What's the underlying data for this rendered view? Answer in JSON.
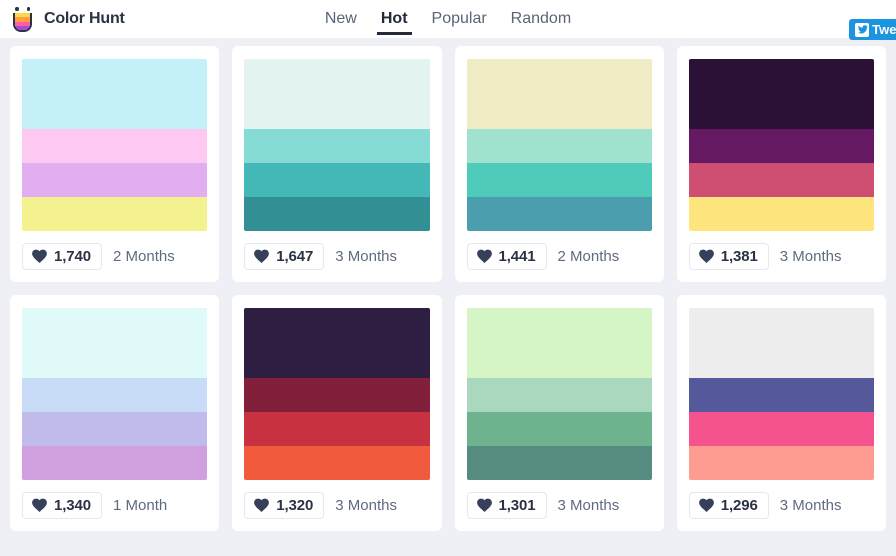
{
  "header": {
    "brand_name": "Color Hunt",
    "logo_icon": "color-hunt-cup-icon",
    "logo_colors": [
      "#ffd54a",
      "#ff9f40",
      "#ff5fa2",
      "#a64ad1"
    ],
    "nav": [
      {
        "label": "New",
        "active": false
      },
      {
        "label": "Hot",
        "active": true
      },
      {
        "label": "Popular",
        "active": false
      },
      {
        "label": "Random",
        "active": false
      }
    ],
    "tweet_widget": {
      "label": "Tweet",
      "icon": "twitter-bird-icon",
      "color": "#1b95e0"
    }
  },
  "theme": {
    "page_background": "#eef0f5",
    "card_background": "#ffffff",
    "text_primary": "#2b3245",
    "text_secondary": "#5f6b80",
    "accent": "#1b95e0"
  },
  "palettes": [
    {
      "colors": [
        "#c4f1f7",
        "#fdc8f2",
        "#e2aef2",
        "#f3f28f"
      ],
      "likes": "1,740",
      "age": "2 Months",
      "heart_icon": "heart-icon"
    },
    {
      "colors": [
        "#e2f3f0",
        "#86dcd4",
        "#44b8b6",
        "#328f93"
      ],
      "likes": "1,647",
      "age": "3 Months",
      "heart_icon": "heart-icon"
    },
    {
      "colors": [
        "#efecc6",
        "#a0e2cd",
        "#4ecbbb",
        "#4a9eae"
      ],
      "likes": "1,441",
      "age": "2 Months",
      "heart_icon": "heart-icon"
    },
    {
      "colors": [
        "#2b1136",
        "#651962",
        "#ce4f72",
        "#ffe57e"
      ],
      "likes": "1,381",
      "age": "3 Months",
      "heart_icon": "heart-icon"
    },
    {
      "colors": [
        "#dffaf9",
        "#c9dcf7",
        "#c0bbeb",
        "#cf9fe0"
      ],
      "likes": "1,340",
      "age": "1 Month",
      "heart_icon": "heart-icon"
    },
    {
      "colors": [
        "#2e1f42",
        "#82203c",
        "#c8313f",
        "#f15a3d"
      ],
      "likes": "1,320",
      "age": "3 Months",
      "heart_icon": "heart-icon"
    },
    {
      "colors": [
        "#d6f5c6",
        "#a9d8bf",
        "#6fb28e",
        "#558c7f"
      ],
      "likes": "1,301",
      "age": "3 Months",
      "heart_icon": "heart-icon"
    },
    {
      "colors": [
        "#ededed",
        "#55599b",
        "#f4538d",
        "#fe9c92"
      ],
      "likes": "1,296",
      "age": "3 Months",
      "heart_icon": "heart-icon"
    }
  ]
}
